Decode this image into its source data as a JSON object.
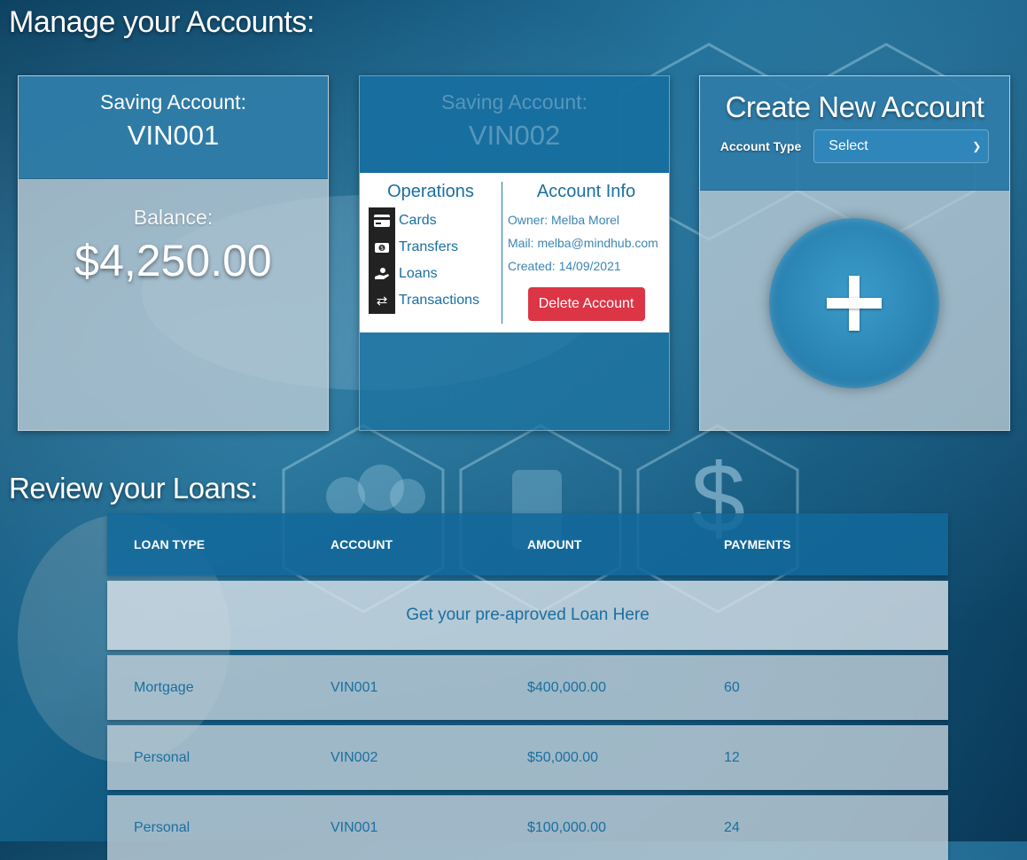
{
  "page": {
    "heading": "Manage your Accounts:",
    "loans_heading": "Review your Loans:"
  },
  "accounts": [
    {
      "label": "Saving Account:",
      "number": "VIN001",
      "balance_label": "Balance:",
      "balance": "$4,250.00"
    },
    {
      "label": "Saving Account:",
      "number": "VIN002",
      "operations_title": "Operations",
      "operations": [
        {
          "label": "Cards",
          "icon": "credit-card-icon"
        },
        {
          "label": "Transfers",
          "icon": "money-transfer-icon"
        },
        {
          "label": "Loans",
          "icon": "hand-money-icon"
        },
        {
          "label": "Transactions",
          "icon": "arrows-exchange-icon"
        }
      ],
      "info_title": "Account Info",
      "owner": "Owner: Melba Morel",
      "mail": "Mail: melba@mindhub.com",
      "created": "Created: 14/09/2021",
      "delete_label": "Delete Account"
    }
  ],
  "create": {
    "title": "Create New Account",
    "type_label": "Account Type",
    "type_value": "Select"
  },
  "loans": {
    "headers": [
      "LOAN TYPE",
      "ACCOUNT",
      "AMOUNT",
      "PAYMENTS"
    ],
    "promo": "Get your pre-aproved Loan Here",
    "rows": [
      [
        "Mortgage",
        "VIN001",
        "$400,000.00",
        "60"
      ],
      [
        "Personal",
        "VIN002",
        "$50,000.00",
        "12"
      ],
      [
        "Personal",
        "VIN001",
        "$100,000.00",
        "24"
      ]
    ]
  },
  "colors": {
    "accent": "#1a6fa0",
    "delete": "#dc3545"
  }
}
